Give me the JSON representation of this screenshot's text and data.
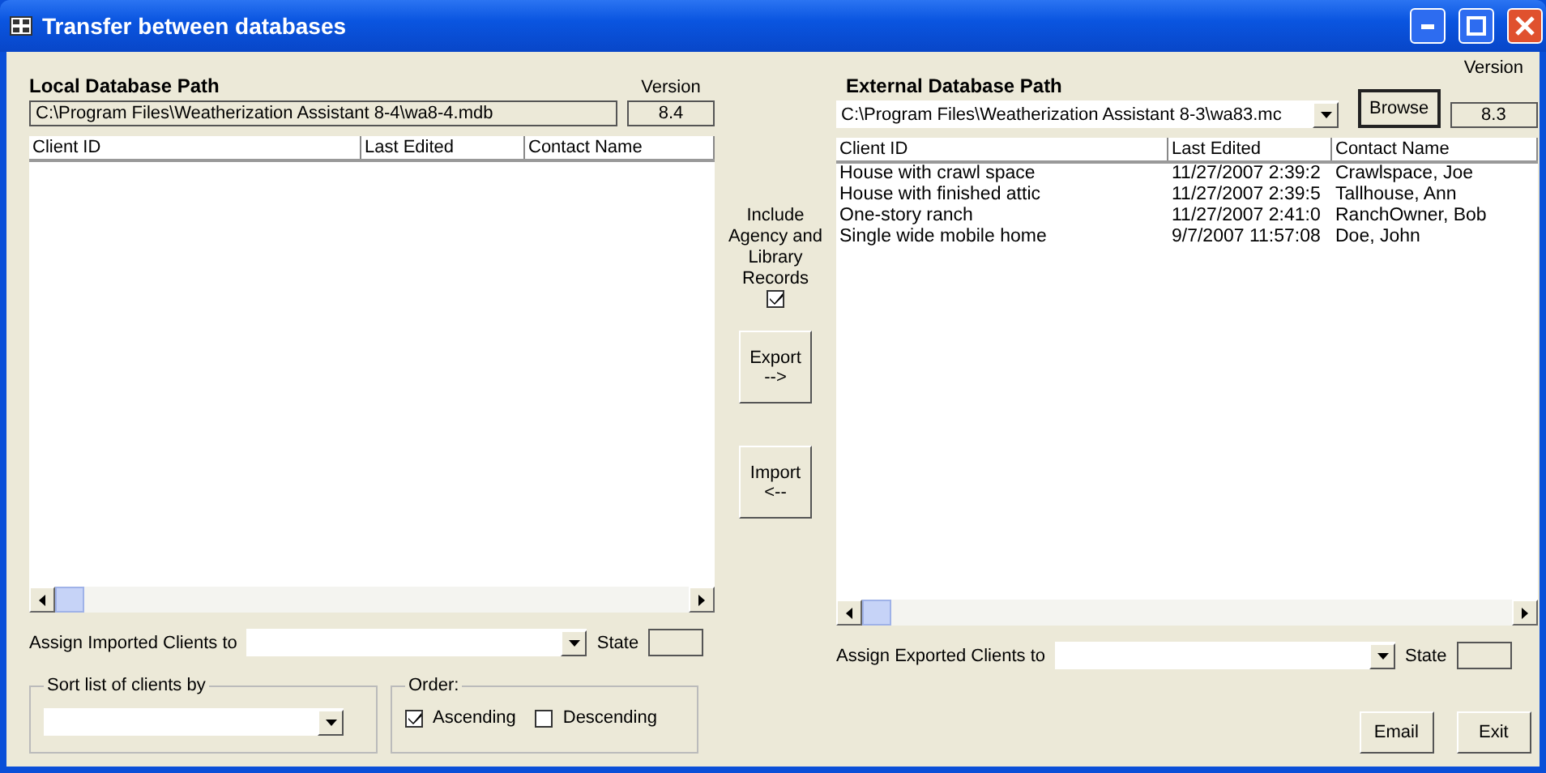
{
  "window": {
    "title": "Transfer between databases"
  },
  "local": {
    "heading": "Local Database Path",
    "version_label": "Version",
    "path": "C:\\Program Files\\Weatherization Assistant 8-4\\wa8-4.mdb",
    "version": "8.4",
    "columns": [
      "Client ID",
      "Last Edited",
      "Contact Name"
    ],
    "assign_label": "Assign Imported Clients to",
    "state_label": "State"
  },
  "middle": {
    "include_label": "Include Agency and Library Records",
    "include_checked": true,
    "export_label": "Export\n-->",
    "import_label": "Import\n<--"
  },
  "external": {
    "heading": "External Database Path",
    "version_label": "Version",
    "path": "C:\\Program Files\\Weatherization Assistant 8-3\\wa83.mc",
    "browse_label": "Browse",
    "version": "8.3",
    "columns": [
      "Client ID",
      "Last Edited",
      "Contact Name"
    ],
    "rows": [
      [
        "House with crawl space",
        "11/27/2007 2:39:2",
        "Crawlspace, Joe"
      ],
      [
        "House with finished attic",
        "11/27/2007 2:39:5",
        "Tallhouse, Ann"
      ],
      [
        "One-story ranch",
        "11/27/2007 2:41:0",
        "RanchOwner, Bob"
      ],
      [
        "Single wide mobile home",
        "9/7/2007 11:57:08",
        "Doe, John"
      ]
    ],
    "assign_label": "Assign Exported Clients to",
    "state_label": "State"
  },
  "sort": {
    "legend": "Sort list of clients by"
  },
  "order": {
    "legend": "Order:",
    "options": [
      {
        "label": "Ascending",
        "checked": true
      },
      {
        "label": "Descending",
        "checked": false
      }
    ]
  },
  "buttons": [
    "Email",
    "Exit"
  ]
}
